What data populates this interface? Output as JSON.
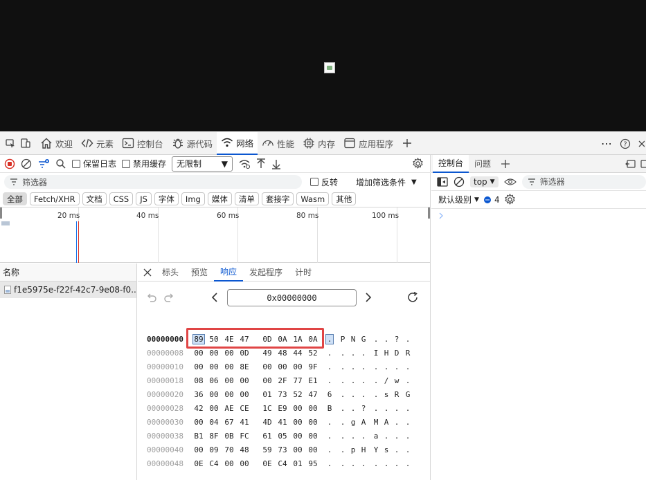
{
  "main_tabs": [
    {
      "label": "欢迎",
      "icon": "home-icon"
    },
    {
      "label": "元素",
      "icon": "code-tags-icon"
    },
    {
      "label": "控制台",
      "icon": "console-icon"
    },
    {
      "label": "源代码",
      "icon": "bug-icon"
    },
    {
      "label": "网络",
      "icon": "wifi-icon",
      "active": true
    },
    {
      "label": "性能",
      "icon": "performance-icon"
    },
    {
      "label": "内存",
      "icon": "chip-icon"
    },
    {
      "label": "应用程序",
      "icon": "app-window-icon"
    }
  ],
  "network_toolbar": {
    "preserve_log": "保留日志",
    "disable_cache": "禁用缓存",
    "throttle_value": "无限制"
  },
  "filter": {
    "placeholder": "筛选器",
    "invert": "反转",
    "more_filters": "增加筛选条件"
  },
  "type_filters": [
    "全部",
    "Fetch/XHR",
    "文档",
    "CSS",
    "JS",
    "字体",
    "Img",
    "媒体",
    "清单",
    "套接字",
    "Wasm",
    "其他"
  ],
  "timeline_ticks": [
    "20 ms",
    "40 ms",
    "60 ms",
    "80 ms",
    "100 ms"
  ],
  "requests": {
    "header": "名称",
    "rows": [
      "f1e5975e-f22f-42c7-9e08-f0..."
    ]
  },
  "detail_tabs": [
    "标头",
    "预览",
    "响应",
    "发起程序",
    "计时"
  ],
  "active_detail_tab": "响应",
  "hex_viewer": {
    "address": "0x00000000",
    "rows": [
      {
        "offset": "00000000",
        "bytes": [
          "89",
          "50",
          "4E",
          "47",
          "0D",
          "0A",
          "1A",
          "0A"
        ],
        "ascii": [
          ".",
          "P",
          "N",
          "G",
          ".",
          ".",
          "?",
          "."
        ]
      },
      {
        "offset": "00000008",
        "bytes": [
          "00",
          "00",
          "00",
          "0D",
          "49",
          "48",
          "44",
          "52"
        ],
        "ascii": [
          ".",
          ".",
          ".",
          ".",
          "I",
          "H",
          "D",
          "R"
        ]
      },
      {
        "offset": "00000010",
        "bytes": [
          "00",
          "00",
          "00",
          "8E",
          "00",
          "00",
          "00",
          "9F"
        ],
        "ascii": [
          ".",
          ".",
          ".",
          ".",
          ".",
          ".",
          ".",
          "."
        ]
      },
      {
        "offset": "00000018",
        "bytes": [
          "08",
          "06",
          "00",
          "00",
          "00",
          "2F",
          "77",
          "E1"
        ],
        "ascii": [
          ".",
          ".",
          ".",
          ".",
          ".",
          "/",
          "w",
          "."
        ]
      },
      {
        "offset": "00000020",
        "bytes": [
          "36",
          "00",
          "00",
          "00",
          "01",
          "73",
          "52",
          "47"
        ],
        "ascii": [
          "6",
          ".",
          ".",
          ".",
          ".",
          "s",
          "R",
          "G"
        ]
      },
      {
        "offset": "00000028",
        "bytes": [
          "42",
          "00",
          "AE",
          "CE",
          "1C",
          "E9",
          "00",
          "00"
        ],
        "ascii": [
          "B",
          ".",
          ".",
          "?",
          ".",
          ".",
          ".",
          "."
        ]
      },
      {
        "offset": "00000030",
        "bytes": [
          "00",
          "04",
          "67",
          "41",
          "4D",
          "41",
          "00",
          "00"
        ],
        "ascii": [
          ".",
          ".",
          "g",
          "A",
          "M",
          "A",
          ".",
          "."
        ]
      },
      {
        "offset": "00000038",
        "bytes": [
          "B1",
          "8F",
          "0B",
          "FC",
          "61",
          "05",
          "00",
          "00"
        ],
        "ascii": [
          ".",
          ".",
          ".",
          ".",
          "a",
          ".",
          ".",
          "."
        ]
      },
      {
        "offset": "00000040",
        "bytes": [
          "00",
          "09",
          "70",
          "48",
          "59",
          "73",
          "00",
          "00"
        ],
        "ascii": [
          ".",
          ".",
          "p",
          "H",
          "Y",
          "s",
          ".",
          "."
        ]
      },
      {
        "offset": "00000048",
        "bytes": [
          "0E",
          "C4",
          "00",
          "00",
          "0E",
          "C4",
          "01",
          "95"
        ],
        "ascii": [
          ".",
          ".",
          ".",
          ".",
          ".",
          ".",
          ".",
          "."
        ]
      }
    ]
  },
  "console_drawer": {
    "tabs": [
      "控制台",
      "问题"
    ],
    "context": "top",
    "filter_placeholder": "筛选器",
    "level": "默认级别",
    "message_count": "4"
  },
  "colors": {
    "accent": "#0b57d0",
    "highlight_box": "#e04545",
    "record_red": "#d93025"
  }
}
